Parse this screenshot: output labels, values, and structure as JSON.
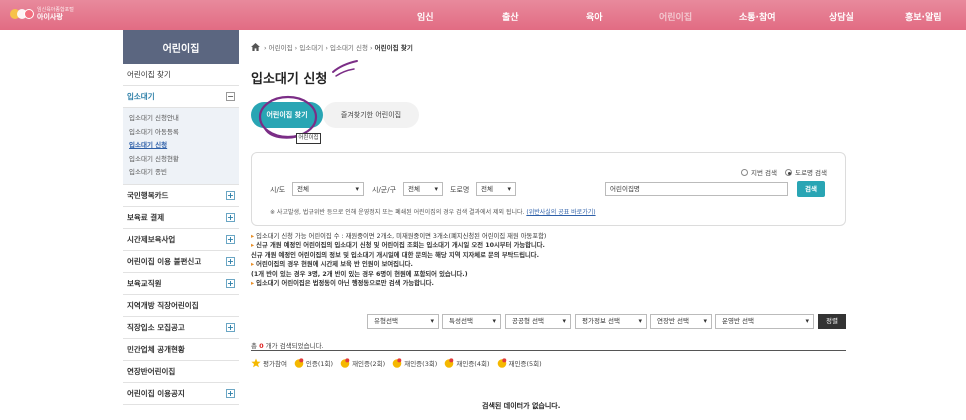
{
  "brand": {
    "top": "임신육아종합포털",
    "name": "아이사랑"
  },
  "menu": [
    "임신",
    "출산",
    "육아",
    "어린이집",
    "소통·참여",
    "상담실",
    "홍보·알림"
  ],
  "sidebar": {
    "title": "어린이집",
    "items_before": [
      "어린이집 찾기"
    ],
    "open_item": "입소대기",
    "sub_items": [
      "입소대기 신청안내",
      "입소대기 아동등록",
      "입소대기 신청",
      "입소대기 신청현황",
      "입소대기 종빈"
    ],
    "items_after": [
      "국민행복카드",
      "보육료 결제",
      "시간제보육사업",
      "어린이집 이용 불편신고",
      "보육교직원",
      "지역개방 직장어린이집",
      "직장입소 모집공고",
      "민간업체 공개현황",
      "연장반어린이집",
      "어린이집 이용공지"
    ]
  },
  "breadcrumb": [
    "어린이집",
    "입소대기",
    "입소대기 신청",
    "어린이집 찾기"
  ],
  "page_title": "입소대기 신청",
  "tabs": {
    "active": "어린이집 찾기",
    "inactive": "즐겨찾기한 어린이집",
    "tip": "어린이집"
  },
  "search": {
    "radio_jibun": "지번 검색",
    "radio_road": "도로명 검색",
    "sido_label": "시/도",
    "sido_value": "전체",
    "sigungu_label": "시/군/구",
    "sigungu_value": "전체",
    "doro_label": "도로명",
    "doro_value": "전체",
    "name_value": "어린이집명",
    "button": "검색",
    "notice": "※ 사고발생, 법규위반 등으로 인해 운영정지 또는 폐쇄된 어린이집의 경우 검색 결과에서 제외 됩니다.",
    "notice_link": "(위반사실의 공표 바로가기)"
  },
  "info_lines": [
    "입소대기 신청 가능 어린이집 수 : 재원중이면 2개소, 미재원중이면 3개소(폐지신청된 어린이집 재원 아동포함)",
    "신규 개원 예정인 어린이집의 입소대기 신청 및 어린이집 조회는 입소대기 개시일 오전 10시부터 가능합니다.",
    "신규 개원 예정인 어린이집의 정보 및 입소대기 개시일에 대한 문의는 해당 지역 지자체로 문의 부탁드립니다.",
    "어린이집의 경우 현원에 시간제 보육 반 인원이 보여집니다.",
    "(1개 반이 있는 경우 3명, 2개 반이 있는 경우 6명이 현원에 포함되어 있습니다.)",
    "입소대기 어린이집은 법정동이 아닌 행정동으로만 검색 가능합니다."
  ],
  "filters": [
    "유형선택",
    "특성선택",
    "공공형 선택",
    "평가정보 선택",
    "연장반 선택",
    "운영반 선택"
  ],
  "sort_button": "정렬",
  "result_count": {
    "prefix": "총",
    "count": "0",
    "suffix": "개가 검색되었습니다."
  },
  "legend": [
    "평가참여",
    "인증(1회)",
    "재인증(2회)",
    "재인증(3회)",
    "재인증(4회)",
    "재인증(5회)"
  ],
  "empty_message": "검색된 데이터가 없습니다.",
  "colors": {
    "topnav": "#e26c83",
    "accent": "#29a5b4",
    "sidebar_title": "#5b6680",
    "annotation": "#7b2d86"
  }
}
